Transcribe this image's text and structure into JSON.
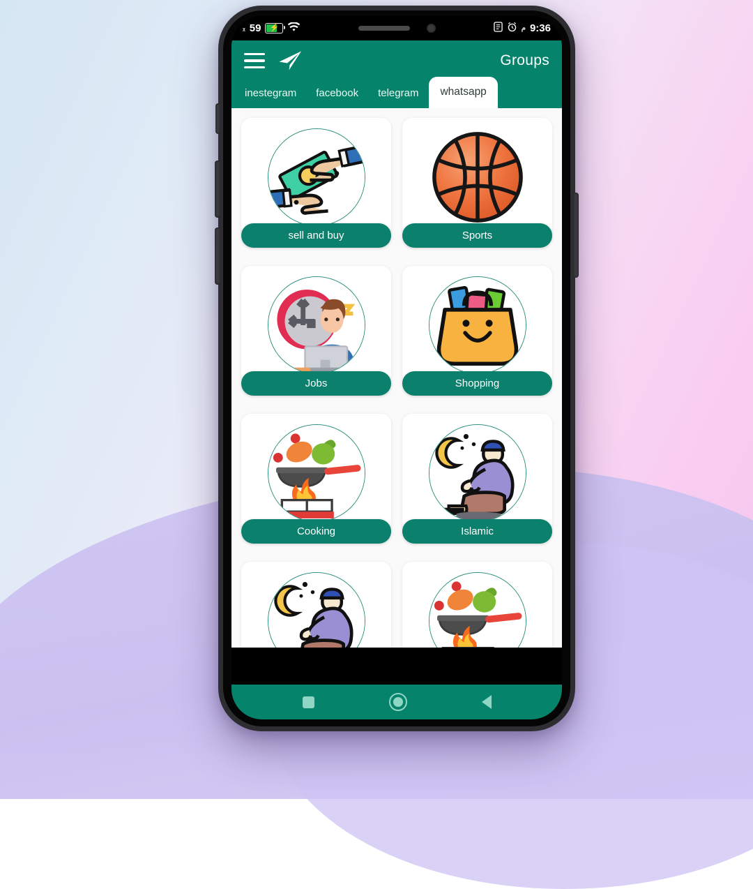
{
  "status_bar": {
    "battery_level": "59",
    "battery_icon": "battery-charging-icon",
    "wifi_icon": "wifi-icon",
    "sim_icon": "sim-card-icon",
    "alarm_icon": "alarm-clock-icon",
    "meridiem": "م",
    "time": "9:36"
  },
  "app_bar": {
    "menu_icon": "hamburger-menu-icon",
    "send_icon": "paper-plane-icon",
    "title": "Groups"
  },
  "tabs": [
    {
      "label": "inestegram",
      "active": false
    },
    {
      "label": "facebook",
      "active": false
    },
    {
      "label": "telegram",
      "active": false
    },
    {
      "label": "whatsapp",
      "active": true
    }
  ],
  "groups": [
    {
      "label": "sell and buy",
      "icon": "money-exchange-hands-icon"
    },
    {
      "label": "Sports",
      "icon": "basketball-icon"
    },
    {
      "label": "Jobs",
      "icon": "office-worker-clock-icon"
    },
    {
      "label": "Shopping",
      "icon": "shopping-bag-icon"
    },
    {
      "label": "Cooking",
      "icon": "frying-pan-fire-icon"
    },
    {
      "label": "Islamic",
      "icon": "praying-person-crescent-icon"
    },
    {
      "label": "",
      "icon": "praying-person-crescent-icon"
    },
    {
      "label": "",
      "icon": "frying-pan-fire-icon"
    }
  ],
  "nav_bar": {
    "recents_icon": "square-recents-icon",
    "home_icon": "circle-home-icon",
    "back_icon": "triangle-back-icon"
  },
  "colors": {
    "brand_green": "#05836b",
    "pill_green": "#0b806c",
    "tab_active_bg": "#ffffff",
    "content_bg": "#fafafa",
    "nav_icon": "#8fd6c5"
  }
}
